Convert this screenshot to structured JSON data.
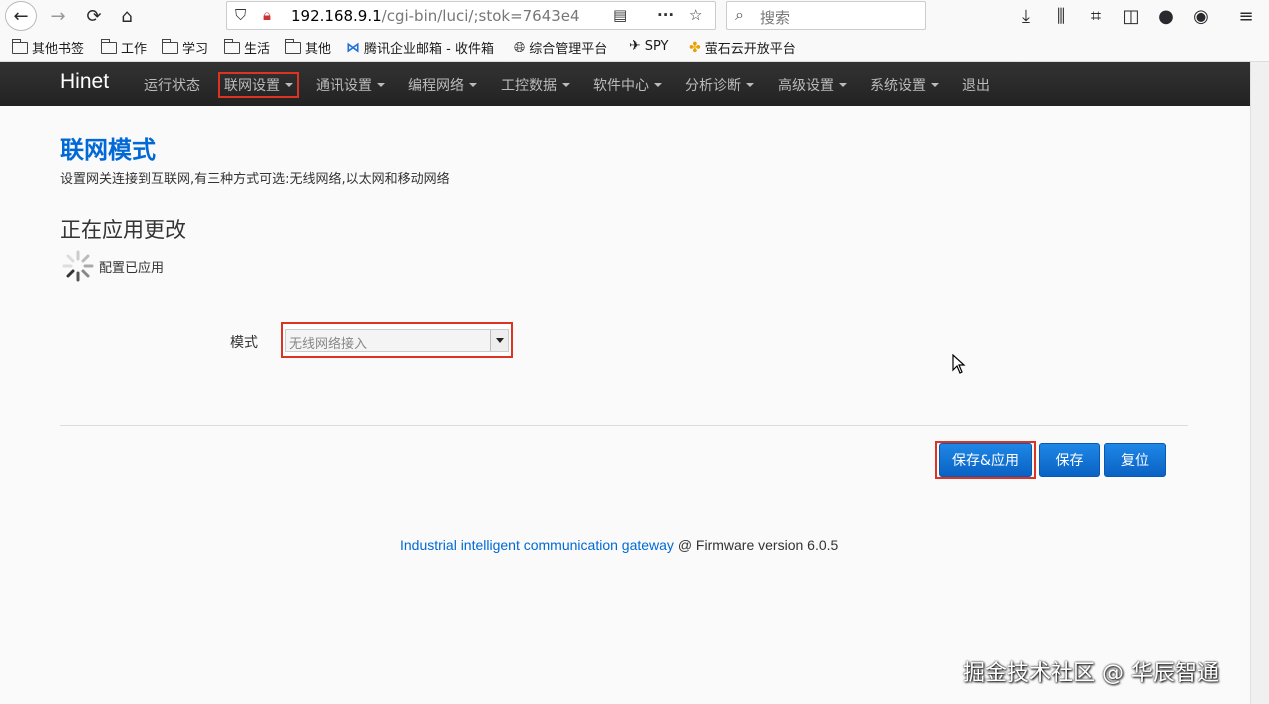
{
  "browser": {
    "url_host": "192.168.9.1",
    "url_path": "/cgi-bin/luci/;stok=7643e4",
    "search_placeholder": "搜索"
  },
  "bookmarks": [
    {
      "label": "其他书签",
      "icon": "folder-icon"
    },
    {
      "label": "工作",
      "icon": "folder-icon"
    },
    {
      "label": "学习",
      "icon": "folder-icon"
    },
    {
      "label": "生活",
      "icon": "folder-icon"
    },
    {
      "label": "其他",
      "icon": "folder-icon"
    },
    {
      "label": "腾讯企业邮箱 - 收件箱",
      "icon": "tencent-mail-icon"
    },
    {
      "label": "综合管理平台",
      "icon": "globe-icon"
    },
    {
      "label": "SPY",
      "icon": "plane-icon"
    },
    {
      "label": "萤石云开放平台",
      "icon": "ezviz-icon"
    }
  ],
  "navbar": {
    "brand": "Hinet",
    "items": [
      {
        "label": "运行状态",
        "dropdown": false
      },
      {
        "label": "联网设置",
        "dropdown": true,
        "highlighted": true
      },
      {
        "label": "通讯设置",
        "dropdown": true
      },
      {
        "label": "编程网络",
        "dropdown": true
      },
      {
        "label": "工控数据",
        "dropdown": true
      },
      {
        "label": "软件中心",
        "dropdown": true
      },
      {
        "label": "分析诊断",
        "dropdown": true
      },
      {
        "label": "高级设置",
        "dropdown": true
      },
      {
        "label": "系统设置",
        "dropdown": true
      },
      {
        "label": "退出",
        "dropdown": false
      }
    ]
  },
  "content": {
    "title": "联网模式",
    "description": "设置网关连接到互联网,有三种方式可选:无线网络,以太网和移动网络",
    "apply_title": "正在应用更改",
    "apply_status": "配置已应用",
    "mode_label": "模式",
    "mode_value": "无线网络接入"
  },
  "buttons": {
    "save_apply": "保存&应用",
    "save": "保存",
    "reset": "复位"
  },
  "footer": {
    "link": "Industrial intelligent communication gateway",
    "text": " @ Firmware version 6.0.5"
  },
  "watermark": "掘金技术社区 @ 华辰智通",
  "colors": {
    "accent": "#0069d6",
    "highlight": "#dd3322",
    "navbar": "#222222"
  }
}
